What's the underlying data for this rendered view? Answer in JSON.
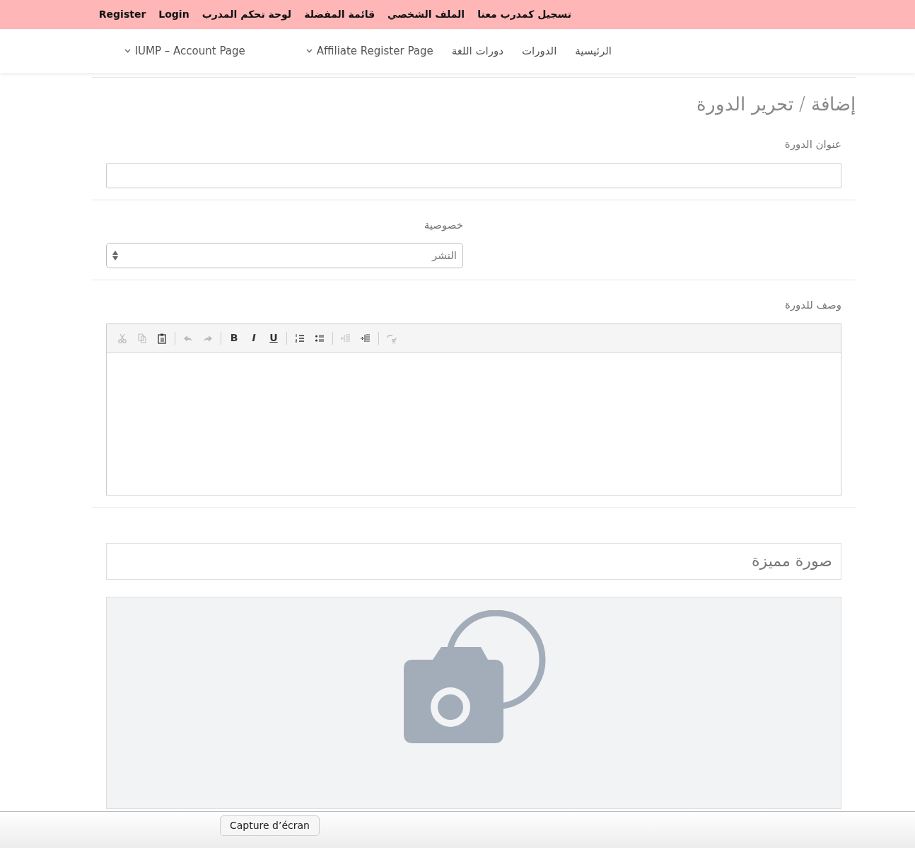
{
  "top_bar": {
    "links": [
      "تسجيل كمدرب معنا",
      "الملف الشخصي",
      "قائمة المفضلة",
      "لوحة تحكم المدرب",
      "Login",
      "Register"
    ]
  },
  "nav": {
    "items": [
      {
        "label": "الرئيسية",
        "dropdown": false
      },
      {
        "label": "الدورات",
        "dropdown": false
      },
      {
        "label": "دورات اللغة",
        "dropdown": false
      },
      {
        "label": "Affiliate Register Page",
        "dropdown": true
      },
      {
        "label": "IUMP – Account Page",
        "dropdown": true
      }
    ]
  },
  "form": {
    "title": "إضافة / تحرير الدورة",
    "course_title": {
      "label": "عنوان الدورة"
    },
    "privacy": {
      "label": "خصوصية",
      "value": "النشر"
    },
    "description": {
      "label": "وصف للدورة",
      "toolbar": [
        [
          {
            "kind": "unlink",
            "disabled": true
          }
        ],
        [
          {
            "kind": "indent",
            "disabled": false
          },
          {
            "kind": "outdent",
            "disabled": true
          }
        ],
        [
          {
            "kind": "bullet-list",
            "disabled": false
          },
          {
            "kind": "numbered-list",
            "disabled": false
          }
        ],
        [
          {
            "kind": "underline",
            "label": "U",
            "disabled": false
          },
          {
            "kind": "italic",
            "label": "I",
            "disabled": false
          },
          {
            "kind": "bold",
            "label": "B",
            "disabled": false
          }
        ],
        [
          {
            "kind": "redo",
            "disabled": true
          },
          {
            "kind": "undo",
            "disabled": true
          }
        ],
        [
          {
            "kind": "paste",
            "disabled": false
          },
          {
            "kind": "copy",
            "disabled": true
          },
          {
            "kind": "cut",
            "disabled": true
          }
        ]
      ]
    },
    "featured_image": {
      "title": "صورة مميزة"
    }
  },
  "dock": {
    "tooltip": "Capture d’écran"
  }
}
